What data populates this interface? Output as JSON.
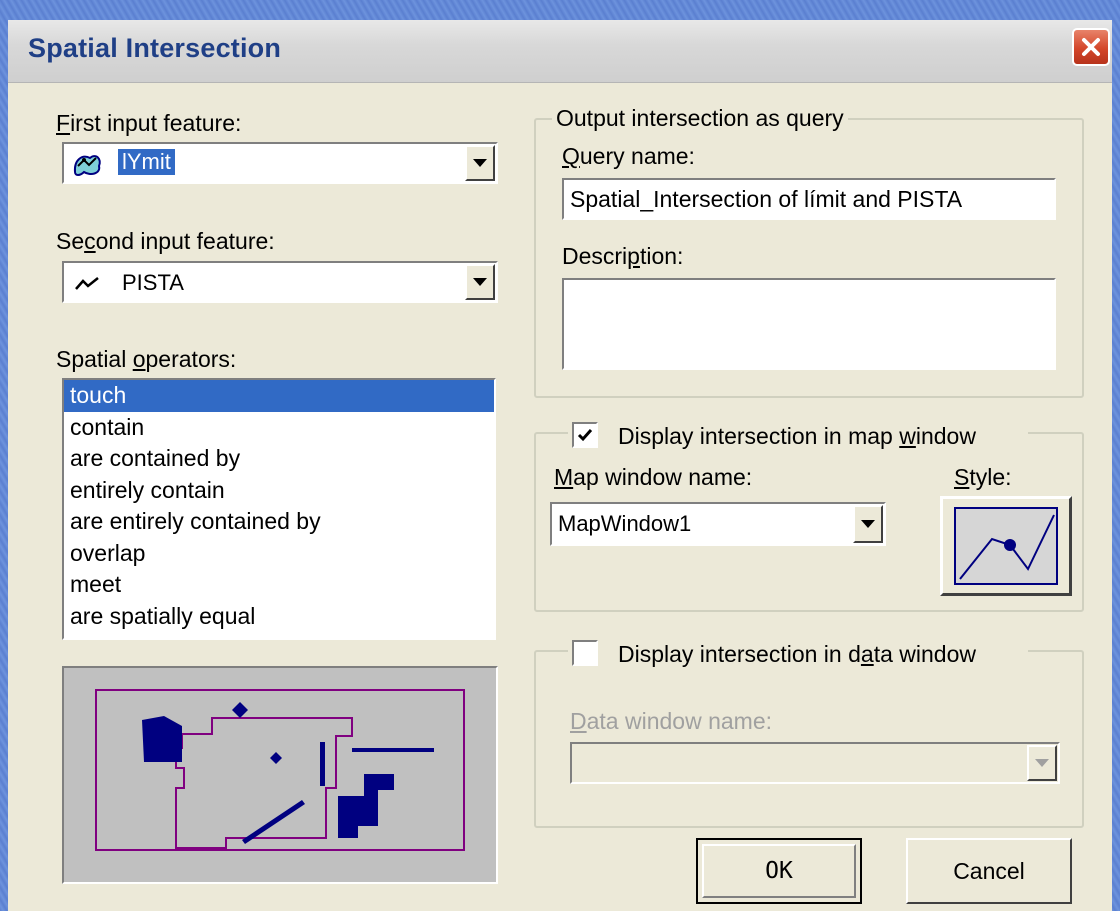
{
  "window": {
    "title": "Spatial Intersection"
  },
  "first_input": {
    "label": "First input feature:",
    "value": "lYmit",
    "icon": "region-icon"
  },
  "second_input": {
    "label": "Second input feature:",
    "value": "PISTA",
    "icon": "line-icon"
  },
  "spatial_operators": {
    "label": "Spatial operators:",
    "items": [
      "touch",
      "contain",
      "are contained by",
      "entirely contain",
      "are entirely contained by",
      "overlap",
      "meet",
      "are spatially equal"
    ],
    "selected_index": 0
  },
  "output_query": {
    "legend": "Output intersection as query",
    "query_name_label": "Query name:",
    "query_name_value": "Spatial_Intersection of límit and PISTA",
    "description_label": "Description:",
    "description_value": ""
  },
  "map_display": {
    "legend": "Display intersection in map window",
    "checked": true,
    "map_window_label": "Map window name:",
    "map_window_value": "MapWindow1",
    "style_label": "Style:"
  },
  "data_display": {
    "legend": "Display intersection in data window",
    "checked": false,
    "data_window_label": "Data window name:",
    "data_window_value": ""
  },
  "buttons": {
    "ok": "OK",
    "cancel": "Cancel"
  },
  "colors": {
    "selection": "#316ac5",
    "preview_shapes": "#000080",
    "preview_border": "#800080",
    "close_button": "#d4462a"
  }
}
